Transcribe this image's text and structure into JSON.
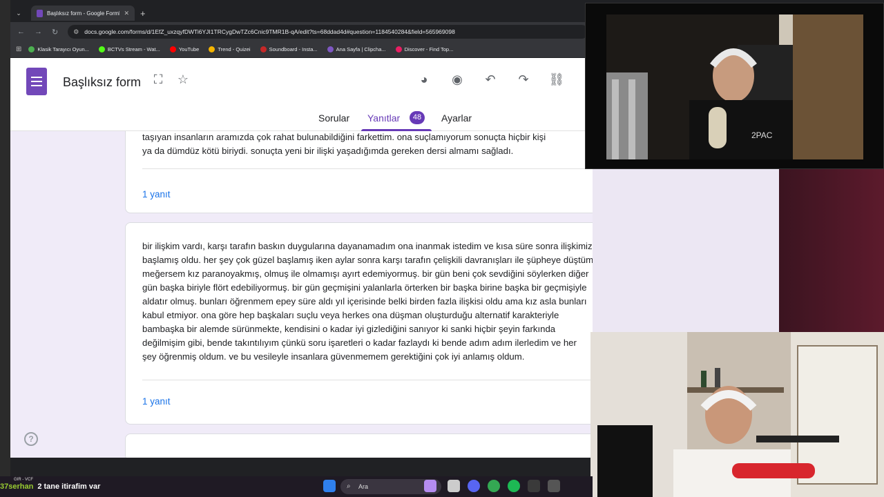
{
  "browser": {
    "tab_title": "Başlıksız form - Google Formlar",
    "url": "docs.google.com/forms/d/1EfZ_uxzqyfDWTi6YJI1TRCygDwTZc6Cnic9TMR1B-qA/edit?ts=68ddad4d#question=1184540284&field=565969098",
    "bookmarks": [
      {
        "label": "Klasik Tarayıcı Oyun...",
        "color": "#4caf50"
      },
      {
        "label": "BCTVs Stream - Wat...",
        "color": "#53fc18"
      },
      {
        "label": "YouTube",
        "color": "#ff0000"
      },
      {
        "label": "Trend - Quizei",
        "color": "#f4b400"
      },
      {
        "label": "Soundboard - Insta...",
        "color": "#c62828"
      },
      {
        "label": "Ana Sayfa | Clipcha...",
        "color": "#7e57c2"
      },
      {
        "label": "Discover - Find Top...",
        "color": "#e91e63"
      }
    ]
  },
  "form": {
    "title": "Başlıksız form",
    "tabs": {
      "questions": "Sorular",
      "responses": "Yanıtlar",
      "settings": "Ayarlar"
    },
    "responses_count": "48"
  },
  "responses": {
    "card1_partial_line": "taşıyan insanların aramızda çok rahat bulunabildiğini farkettim. ona suçlamıyorum sonuçta hiçbir kişi",
    "card1_last_line": "ya da dümdüz kötü biriydi. sonuçta yeni bir ilişki yaşadığımda gereken dersi almamı sağladı.",
    "card1_reply": "1 yanıt",
    "card2_lines": [
      "bir ilişkim vardı, karşı tarafın baskın duygularına dayanamadım ona inanmak istedim ve kısa süre sonra ilişkimiz",
      "başlamış oldu. her şey çok güzel başlamış iken aylar sonra karşı tarafın çelişkili davranışları ile şüpheye düştüm.",
      "meğersem kız paranoyakmış, olmuş ile olmamışı ayırt edemiyormuş. bir gün beni çok sevdiğini söylerken diğer",
      "gün başka biriyle flört edebiliyormuş. bir gün geçmişini yalanlarla örterken bir başka birine başka bir geçmişiyle",
      "aldatır olmuş. bunları öğrenmem epey süre aldı yıl içerisinde belki birden fazla ilişkisi oldu ama kız asla bunları",
      "kabul etmiyor. ona göre hep başkaları suçlu veya herkes ona düşman oluşturduğu alternatif karakteriyle",
      "bambaşka bir alemde sürünmekte, kendisini o kadar iyi gizlediğini sanıyor ki sanki hiçbir şeyin farkında",
      "değilmişim gibi, bende takıntılıyım çünkü soru işaretleri o kadar fazlaydı ki bende adım adım ilerledim ve her",
      "şey öğrenmiş oldum. ve bu vesileyle insanlara güvenmemem gerektiğini çok iyi anlamış oldum."
    ],
    "card2_reply": "1 yanıt"
  },
  "taskbar": {
    "search_placeholder": "Ara"
  },
  "chat": {
    "user": "37serhan",
    "message": "2 tane itirafim var",
    "top_small": "GIR - VCF"
  },
  "colors": {
    "accent": "#673ab7",
    "link": "#1a73e8",
    "page_bg": "#f0ebf8"
  }
}
